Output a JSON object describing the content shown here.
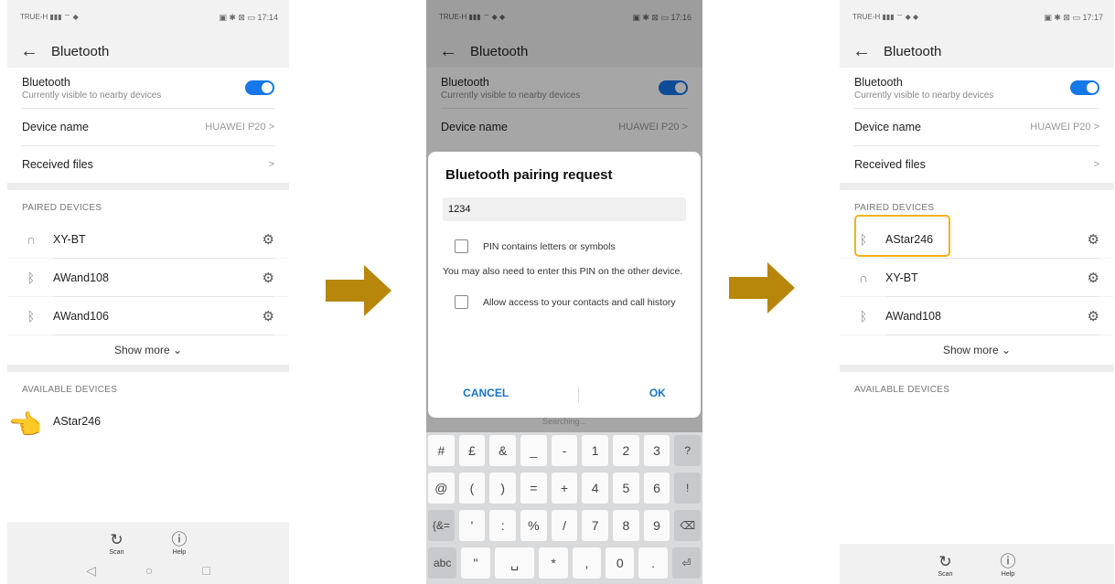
{
  "status": {
    "s1": {
      "left": "TRUE-H  ▮▮▮ ⌔ ◆",
      "right": "▣ ✱ ⊠ ▭ 17:14"
    },
    "s2": {
      "left": "TRUE-H  ▮▮▮ ⌔ ◆ ◆",
      "right": "▣ ✱ ⊠ ▭ 17:16"
    },
    "s3": {
      "left": "TRUE-H  ▮▮▮ ⌔ ◆ ◆",
      "right": "▣ ✱ ⊠ ▭ 17:17"
    }
  },
  "header": {
    "title": "Bluetooth"
  },
  "bluetooth_row": {
    "label": "Bluetooth",
    "sub": "Currently visible to nearby devices",
    "accent": "#1577e8"
  },
  "device_name_row": {
    "label": "Device name",
    "value": "HUAWEI P20 >"
  },
  "received_row": {
    "label": "Received files",
    "chevron": ">"
  },
  "paired_header": "PAIRED DEVICES",
  "available_header": "AVAILABLE DEVICES",
  "show_more": "Show more ⌄",
  "s1_paired": [
    {
      "icon": "headphones-icon",
      "glyph": "∩",
      "name": "XY-BT"
    },
    {
      "icon": "bluetooth-icon",
      "glyph": "ᛒ",
      "name": "AWand108"
    },
    {
      "icon": "bluetooth-icon",
      "glyph": "ᛒ",
      "name": "AWand106"
    }
  ],
  "s1_available": [
    {
      "icon": "bluetooth-icon",
      "glyph": "ᛒ",
      "name": "AStar246"
    }
  ],
  "s3_paired": [
    {
      "icon": "bluetooth-icon",
      "glyph": "ᛒ",
      "name": "AStar246"
    },
    {
      "icon": "headphones-icon",
      "glyph": "∩",
      "name": "XY-BT"
    },
    {
      "icon": "bluetooth-icon",
      "glyph": "ᛒ",
      "name": "AWand108"
    }
  ],
  "bottom": {
    "scan": "Scan",
    "help": "Help"
  },
  "dialog": {
    "title": "Bluetooth pairing request",
    "pin_value": "1234",
    "pin_check": "PIN contains letters or symbols",
    "note": "You may also need to enter this PIN on the other device.",
    "contacts_check": "Allow access to your contacts and call history",
    "cancel": "CANCEL",
    "ok": "OK",
    "searching": "Searching..."
  },
  "keyboard": {
    "rows": [
      [
        "#",
        "£",
        "&",
        "_",
        "-",
        "1",
        "2",
        "3",
        "?"
      ],
      [
        "@",
        "(",
        ")",
        "=",
        "+",
        "4",
        "5",
        "6",
        "!"
      ],
      [
        "{&=",
        "'",
        ":",
        "%",
        "/",
        "7",
        "8",
        "9",
        "⌫"
      ],
      [
        "abc",
        "\"",
        "␣",
        "*",
        ",",
        "0",
        ".",
        "⏎"
      ]
    ]
  },
  "colors": {
    "arrow": "#b8860b",
    "highlight": "#f3b21b",
    "accent": "#1577e8"
  }
}
